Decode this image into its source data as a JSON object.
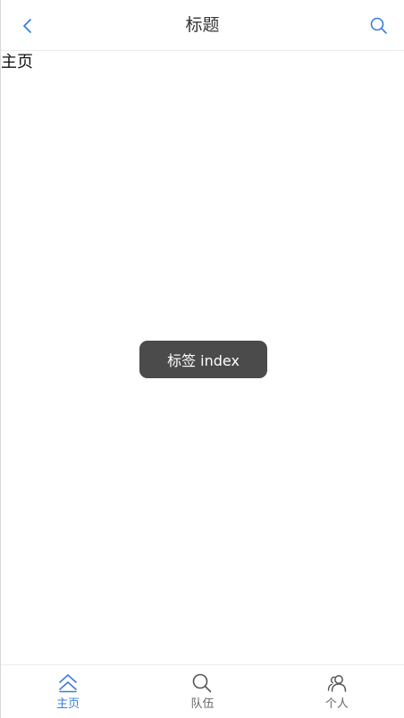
{
  "header": {
    "title": "标题",
    "back_icon": "chevron-left-icon",
    "search_icon": "search-icon"
  },
  "content": {
    "page_label": "主页"
  },
  "toast": {
    "text": "标签 index"
  },
  "tabbar": {
    "tabs": [
      {
        "label": "主页",
        "icon": "home-icon",
        "active": true
      },
      {
        "label": "队伍",
        "icon": "search-icon",
        "active": false
      },
      {
        "label": "个人",
        "icon": "users-icon",
        "active": false
      }
    ]
  },
  "colors": {
    "accent": "#3b7ddd",
    "toast_bg": "#4b4b4b",
    "text_dark": "#333333",
    "text_muted": "#666666"
  }
}
